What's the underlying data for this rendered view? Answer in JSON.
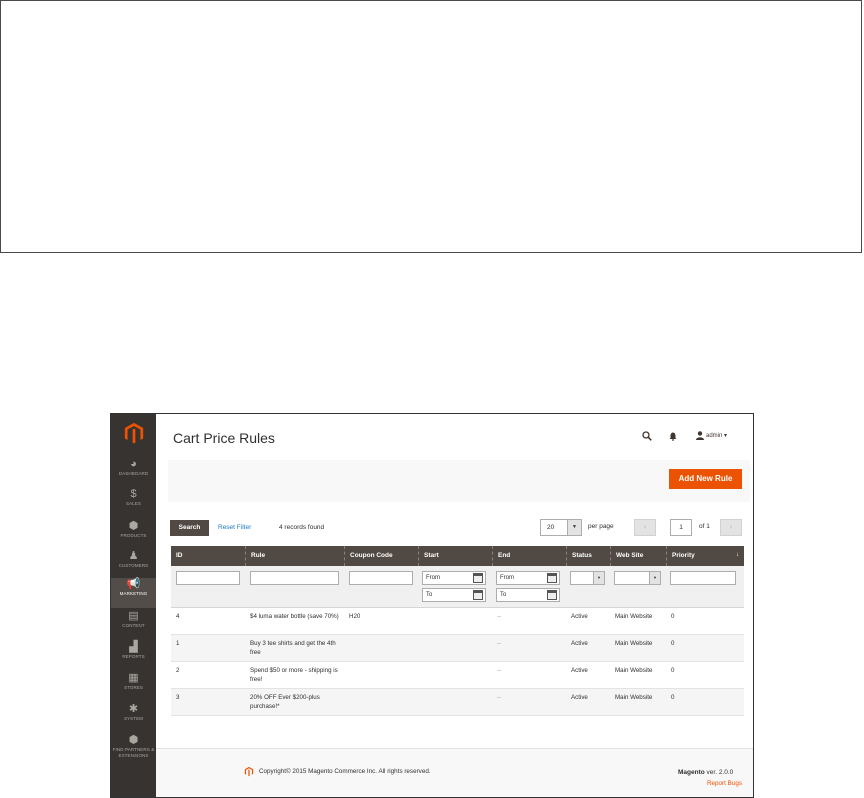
{
  "sidebar": {
    "logo_icon": "magento-logo-icon",
    "items": [
      {
        "label": "DASHBOARD",
        "icon": "dashboard-icon",
        "glyph": "◕"
      },
      {
        "label": "SALES",
        "icon": "dollar-icon",
        "glyph": "$"
      },
      {
        "label": "PRODUCTS",
        "icon": "cube-icon",
        "glyph": "⬢"
      },
      {
        "label": "CUSTOMERS",
        "icon": "person-icon",
        "glyph": "♟"
      },
      {
        "label": "MARKETING",
        "icon": "megaphone-icon",
        "glyph": "📢"
      },
      {
        "label": "CONTENT",
        "icon": "layout-icon",
        "glyph": "▤"
      },
      {
        "label": "REPORTS",
        "icon": "bar-chart-icon",
        "glyph": "▟"
      },
      {
        "label": "STORES",
        "icon": "store-icon",
        "glyph": "▦"
      },
      {
        "label": "SYSTEM",
        "icon": "gear-icon",
        "glyph": "✱"
      },
      {
        "label": "FIND PARTNERS & EXTENSIONS",
        "icon": "box-icon",
        "glyph": "⬢"
      }
    ],
    "active": "MARKETING"
  },
  "header": {
    "title": "Cart Price Rules",
    "user": "admin ▾"
  },
  "toolbar": {
    "add_label": "Add New Rule",
    "search_label": "Search",
    "reset_label": "Reset Filter",
    "records": "4 records found",
    "per_page_value": "20",
    "per_page_label": "per page",
    "page_value": "1",
    "of_pages": "of 1",
    "prev": "‹",
    "next": "›"
  },
  "grid": {
    "columns": [
      "ID",
      "Rule",
      "Coupon Code",
      "Start",
      "End",
      "Status",
      "Web Site",
      "Priority"
    ],
    "sort_glyph": "↓",
    "filters": {
      "start_from": "From",
      "start_to": "To",
      "end_from": "From",
      "end_to": "To"
    },
    "rows": [
      {
        "id": "4",
        "rule": "$4 luma water bottle (save 70%)",
        "coupon": "H20",
        "start": "",
        "end": "--",
        "status": "Active",
        "website": "Main Website",
        "priority": "0"
      },
      {
        "id": "1",
        "rule": "Buy 3 tee shirts and get the 4th free",
        "coupon": "",
        "start": "",
        "end": "--",
        "status": "Active",
        "website": "Main Website",
        "priority": "0"
      },
      {
        "id": "2",
        "rule": "Spend $50 or more - shipping is free!",
        "coupon": "",
        "start": "",
        "end": "--",
        "status": "Active",
        "website": "Main Website",
        "priority": "0"
      },
      {
        "id": "3",
        "rule": "20% OFF Ever $200-plus purchase!*",
        "coupon": "",
        "start": "",
        "end": "--",
        "status": "Active",
        "website": "Main Website",
        "priority": "0"
      }
    ]
  },
  "footer": {
    "copyright": "Copyright© 2015 Magento Commerce Inc. All rights reserved.",
    "brand": "Magento",
    "version": " ver. 2.0.0",
    "report": "Report Bugs"
  },
  "colors": {
    "accent": "#eb5202",
    "sidebar": "#373330",
    "grid_header": "#514943",
    "link": "#1979c3"
  }
}
